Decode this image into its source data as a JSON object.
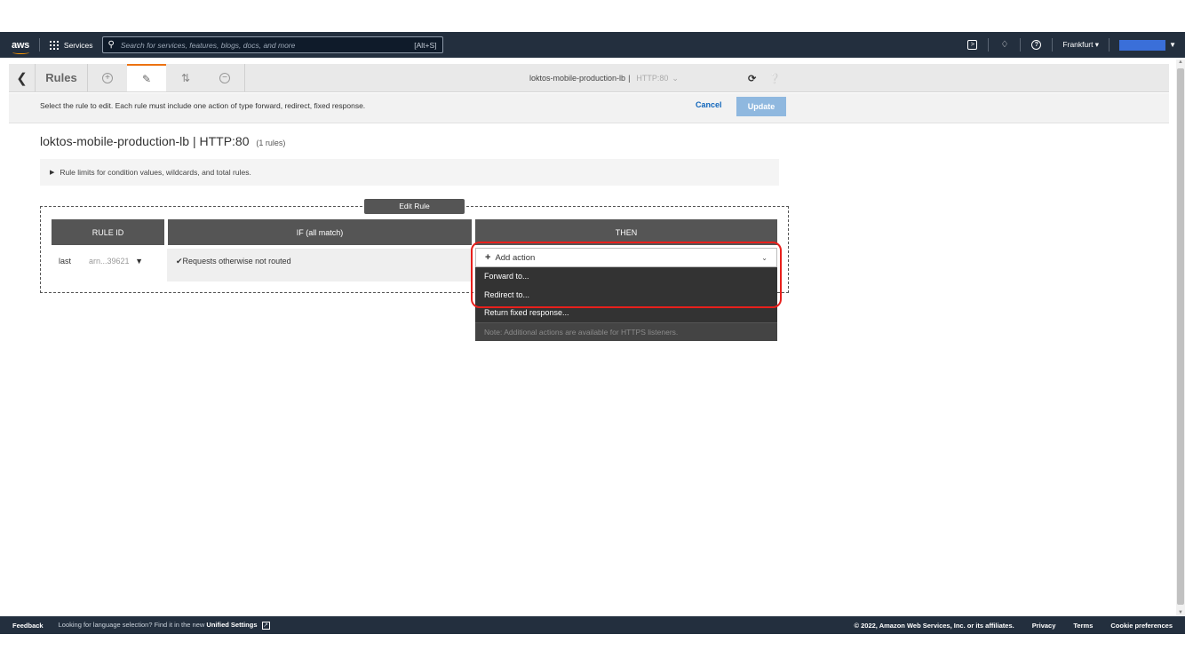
{
  "topnav": {
    "logo": "aws",
    "services_label": "Services",
    "search_placeholder": "Search for services, features, blogs, docs, and more",
    "search_shortcut": "[Alt+S]",
    "region": "Frankfurt",
    "icons": [
      "cloudshell-icon",
      "bell-icon",
      "help-icon"
    ],
    "account_color": "#3a6fd9"
  },
  "toolbar": {
    "title": "Rules",
    "load_balancer": "loktos-mobile-production-lb",
    "separator": "|",
    "listener": "HTTP:80",
    "icons": [
      "back-icon",
      "add-icon",
      "edit-icon",
      "reorder-icon",
      "delete-icon",
      "refresh-icon",
      "help-icon"
    ]
  },
  "instruction": {
    "text": "Select the rule to edit. Each rule must include one action of type forward, redirect, fixed response.",
    "cancel_label": "Cancel",
    "update_label": "Update"
  },
  "main": {
    "lb_heading": "loktos-mobile-production-lb | HTTP:80",
    "rule_count": "(1 rules)",
    "limits_text": "Rule limits for condition values, wildcards, and total rules.",
    "edit_rule_label": "Edit Rule",
    "columns": [
      "RULE ID",
      "IF (all match)",
      "THEN"
    ],
    "row": {
      "priority": "last",
      "rule_id": "arn...39621",
      "condition": "Requests otherwise not routed"
    },
    "add_action_label": "Add action",
    "menu": {
      "items": [
        "Forward to...",
        "Redirect to...",
        "Return fixed response..."
      ],
      "note": "Note: Additional actions are available for HTTPS listeners."
    },
    "highlight_color": "#e8201c"
  },
  "footer": {
    "feedback": "Feedback",
    "lang_text": "Looking for language selection? Find it in the new",
    "lang_link": "Unified Settings",
    "copyright": "© 2022, Amazon Web Services, Inc. or its affiliates.",
    "links": [
      "Privacy",
      "Terms",
      "Cookie preferences"
    ]
  }
}
